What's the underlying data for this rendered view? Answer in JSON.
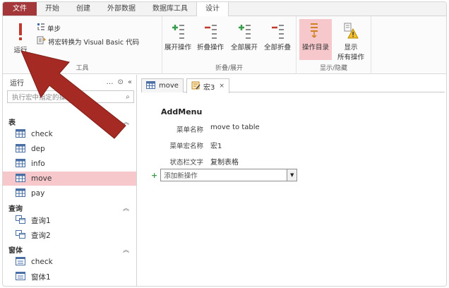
{
  "tabs": [
    {
      "label": "文件"
    },
    {
      "label": "开始"
    },
    {
      "label": "创建"
    },
    {
      "label": "外部数据"
    },
    {
      "label": "数据库工具"
    },
    {
      "label": "设计"
    }
  ],
  "ribbon": {
    "run": "运行",
    "single_step": "单步",
    "convert_vb": "将宏转换为 Visual Basic 代码",
    "tools_group": "工具",
    "expand_action": "展开操作",
    "collapse_action": "折叠操作",
    "expand_all": "全部展开",
    "collapse_all": "全部折叠",
    "collapse_group": "折叠/展开",
    "action_catalog": "操作目录",
    "show_all_actions_l1": "显示",
    "show_all_actions_l2": "所有操作",
    "show_hide_group": "显示/隐藏"
  },
  "nav": {
    "title": "运行",
    "search_placeholder": "执行宏中指定的操作",
    "sections": [
      {
        "label": "表",
        "items": [
          "check",
          "dep",
          "info",
          "move",
          "pay"
        ]
      },
      {
        "label": "查询",
        "items": [
          "查询1",
          "查询2"
        ]
      },
      {
        "label": "窗体",
        "items": [
          "check",
          "窗体1"
        ]
      }
    ],
    "selected": "move"
  },
  "doc": {
    "tabs": [
      {
        "label": "move"
      },
      {
        "label": "宏3"
      }
    ],
    "menu_title": "AddMenu",
    "props": [
      {
        "label": "菜单名称",
        "value": "move to table"
      },
      {
        "label": "菜单宏名称",
        "value": "宏1"
      },
      {
        "label": "状态栏文字",
        "value": "复制表格"
      }
    ],
    "add_action": "添加新操作"
  },
  "colors": {
    "file_tab": "#a4373a",
    "selected_item": "#f6c8cc",
    "annotation_arrow": "#a52a24"
  }
}
